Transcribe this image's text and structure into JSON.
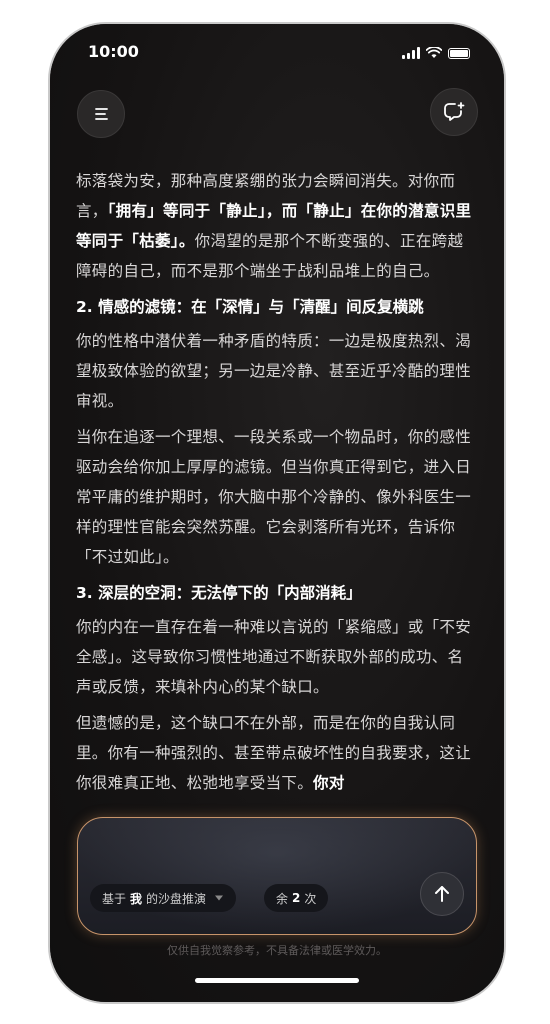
{
  "status_bar": {
    "time": "10:00"
  },
  "header": {
    "menu_icon": "menu-icon",
    "new_chat_icon": "new-chat-icon"
  },
  "article": {
    "p1": {
      "a": "标落袋为安，那种高度紧绷的张力会瞬间消失。对你而言，",
      "b": "「拥有」等同于「静止」，而「静止」在你的潜意识里等同于「枯萎」。",
      "c": "你渴望的是那个不断变强的、正在跨越障碍的自己，而不是那个端坐于战利品堆上的自己。"
    },
    "h2": "2. 情感的滤镜：在「深情」与「清醒」间反复横跳",
    "p2": "你的性格中潜伏着一种矛盾的特质：一边是极度热烈、渴望极致体验的欲望；另一边是冷静、甚至近乎冷酷的理性审视。",
    "p3": "当你在追逐一个理想、一段关系或一个物品时，你的感性驱动会给你加上厚厚的滤镜。但当你真正得到它，进入日常平庸的维护期时，你大脑中那个冷静的、像外科医生一样的理性官能会突然苏醒。它会剥落所有光环，告诉你「不过如此」。",
    "h3": "3. 深层的空洞：无法停下的「内部消耗」",
    "p4": "你的内在一直存在着一种难以言说的「紧缩感」或「不安全感」。这导致你习惯性地通过不断获取外部的成功、名声或反馈，来填补内心的某个缺口。",
    "p5": {
      "a": "但遗憾的是，这个缺口不在外部，而是在你的自我认同里。你有一种强烈的、甚至带点破坏性的自我要求，这让你很难真正地、松弛地享受当下。",
      "b": "你对"
    }
  },
  "input": {
    "mode_prefix": "基于",
    "mode_bold": "我",
    "mode_suffix": "的沙盘推演",
    "quota_prefix": "余",
    "quota_count": "2",
    "quota_suffix": "次"
  },
  "footer": {
    "disclaimer": "仅供自我觉察参考，不具备法律或医学效力。"
  },
  "colors": {
    "background": "#141212",
    "accent_border": "#c7946a",
    "text": "#d8d6d6"
  }
}
